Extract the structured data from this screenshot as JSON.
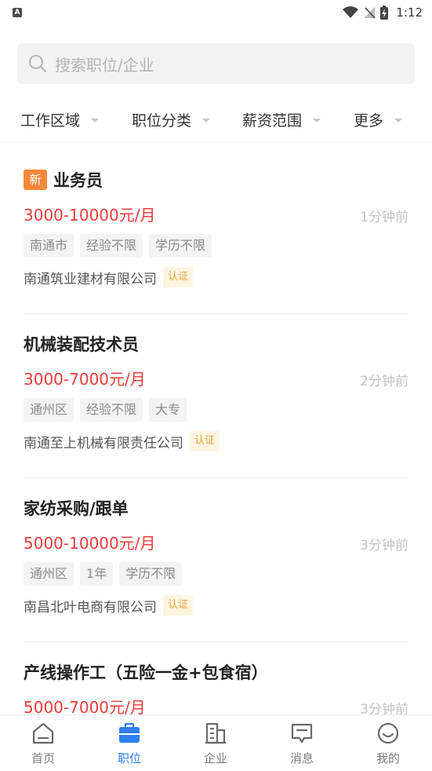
{
  "status_bar": {
    "left_icon": "A",
    "time": "1:12",
    "icons": [
      "wifi-icon",
      "signal-off-icon",
      "battery-charging-icon"
    ]
  },
  "search": {
    "placeholder": "搜索职位/企业"
  },
  "filters": [
    {
      "label": "工作区域"
    },
    {
      "label": "职位分类"
    },
    {
      "label": "薪资范围"
    },
    {
      "label": "更多"
    }
  ],
  "jobs": [
    {
      "is_new": true,
      "new_badge": "新",
      "title": "业务员",
      "salary": "3000-10000元/月",
      "time": "1分钟前",
      "tags": [
        "南通市",
        "经验不限",
        "学历不限"
      ],
      "company": "南通筑业建材有限公司",
      "certified": "认证"
    },
    {
      "is_new": false,
      "title": "机械装配技术员",
      "salary": "3000-7000元/月",
      "time": "2分钟前",
      "tags": [
        "通州区",
        "经验不限",
        "大专"
      ],
      "company": "南通至上机械有限责任公司",
      "certified": "认证"
    },
    {
      "is_new": false,
      "title": "家纺采购/跟单",
      "salary": "5000-10000元/月",
      "time": "3分钟前",
      "tags": [
        "通州区",
        "1年",
        "学历不限"
      ],
      "company": "南昌北叶电商有限公司",
      "certified": "认证"
    },
    {
      "is_new": false,
      "title": "产线操作工（五险一金+包食宿）",
      "salary": "5000-7000元/月",
      "time": "3分钟前",
      "tags": [],
      "company": "",
      "certified": ""
    }
  ],
  "tabs": [
    {
      "label": "首页",
      "icon": "home-icon",
      "active": false
    },
    {
      "label": "职位",
      "icon": "briefcase-icon",
      "active": true
    },
    {
      "label": "企业",
      "icon": "building-icon",
      "active": false
    },
    {
      "label": "消息",
      "icon": "message-icon",
      "active": false
    },
    {
      "label": "我的",
      "icon": "profile-icon",
      "active": false
    }
  ],
  "colors": {
    "accent": "#2d7ef2",
    "salary": "#ee3b3b",
    "new_badge": "#f5883a",
    "cert_text": "#e8a23a",
    "cert_bg": "#fff4e0"
  }
}
